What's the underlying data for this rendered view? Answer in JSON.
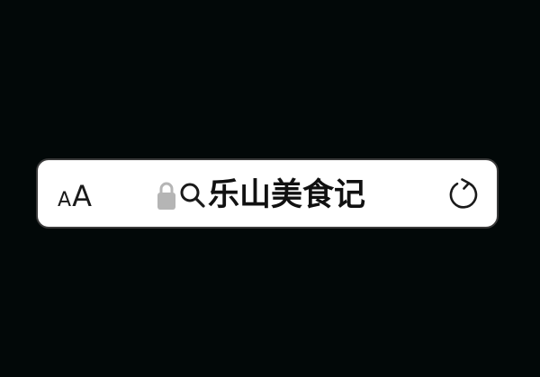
{
  "address_bar": {
    "text_size": {
      "small_label": "A",
      "large_label": "A"
    },
    "lock_icon": "lock-icon",
    "search_icon": "search-icon",
    "query": "乐山美食记",
    "reload_icon": "reload-icon"
  },
  "colors": {
    "background": "#020808",
    "bar_background": "#ffffff",
    "bar_border": "#3a3a3a",
    "lock": "#b5b5b5",
    "text": "#111111"
  }
}
